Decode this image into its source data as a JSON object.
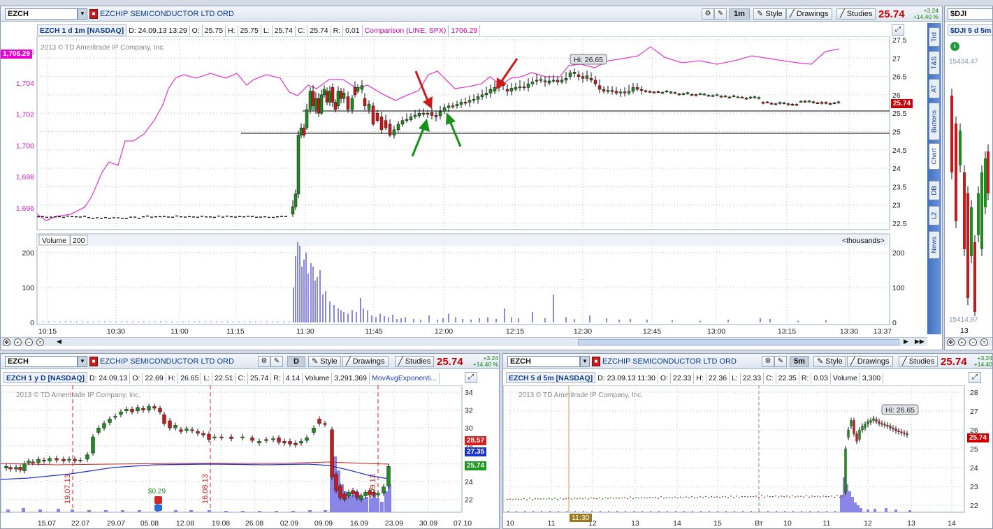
{
  "main": {
    "symbol": "EZCH",
    "company": "EZCHIP SEMICONDUCTOR LTD ORD",
    "timeframe": "1m",
    "style_label": "Style",
    "drawings_label": "Drawings",
    "studies_label": "Studies",
    "last_price": "25.74",
    "change": "+3.24",
    "change_pct": "+14.40 %",
    "info": {
      "title": "EZCH 1 d 1m [NASDAQ]",
      "date": "D: 24.09.13 13:29",
      "o_label": "O:",
      "o": "25.75",
      "h_label": "H:",
      "h": "25.75",
      "l_label": "L:",
      "l": "25.74",
      "c_label": "C:",
      "c": "25.74",
      "r_label": "R:",
      "r": "0.01",
      "comparison": "Comparison (LINE, SPX)",
      "comparison_value": "1706.29"
    },
    "copyright": "2013 © TD Ameritrade IP Company, Inc.",
    "comparison_tag": "1,706.29",
    "price_tag": "25.74",
    "hi_label": "Hi: 26.65",
    "left_axis": [
      "1,706",
      "1,704",
      "1,702",
      "1,700",
      "1,698",
      "1,696"
    ],
    "right_axis": [
      "27.5",
      "27",
      "26.5",
      "26",
      "25.5",
      "25",
      "24.5",
      "24",
      "23.5",
      "23",
      "22.5"
    ],
    "volume_label": "Volume",
    "volume_value": "200",
    "volume_units": "<thousands>",
    "volume_axis": [
      "200",
      "100",
      "0"
    ],
    "time_axis": [
      "10:15",
      "10:30",
      "11:00",
      "11:15",
      "11:30",
      "11:45",
      "12:00",
      "12:15",
      "12:30",
      "12:45",
      "13:00",
      "13:15",
      "13:30",
      "13:37"
    ],
    "side_tabs": [
      "Trd",
      "T&S",
      "AT",
      "Buttons",
      "Chart",
      "DB",
      "L2",
      "News"
    ]
  },
  "right_panel": {
    "symbol": "$DJI",
    "info_title": "$DJI 5 d 5m",
    "price_top": "15434.47",
    "price_bottom": "15414.87",
    "change": "+3.24",
    "change_pct": "+14.40",
    "date_label": "13"
  },
  "bottom_left": {
    "symbol": "EZCH",
    "company": "EZCHIP SEMICONDUCTOR LTD ORD",
    "timeframe": "D",
    "style_label": "Style",
    "drawings_label": "Drawings",
    "studies_label": "Studies",
    "last_price": "25.74",
    "change": "+3.24",
    "change_pct": "+14.40 %",
    "info": {
      "title": "EZCH 1 y D [NASDAQ]",
      "date": "D: 24.09.13",
      "o_label": "O:",
      "o": "22.69",
      "h_label": "H:",
      "h": "26.65",
      "l_label": "L:",
      "l": "22.51",
      "c_label": "C:",
      "c": "25.74",
      "r_label": "R:",
      "r": "4.14",
      "vol_label": "Volume",
      "vol": "3,291,369",
      "study": "MovAvgExponenti..."
    },
    "copyright": "2013 © TD Ameritrade IP Company, Inc.",
    "right_axis": [
      "34",
      "32",
      "30",
      "28",
      "26",
      "24",
      "22"
    ],
    "tags": {
      "red": "28.57",
      "blue": "27.35",
      "green": "25.74"
    },
    "dividend": "$0.29",
    "event_dates": [
      "19.07.13",
      "16.08.13",
      "20.09.13"
    ],
    "time_axis": [
      "15.07",
      "22.07",
      "29.07",
      "05.08",
      "12.08",
      "19.08",
      "26.08",
      "02.09",
      "09.09",
      "16.09",
      "23.09",
      "30.09",
      "07.10"
    ]
  },
  "bottom_right": {
    "symbol": "EZCH",
    "company": "EZCHIP SEMICONDUCTOR LTD ORD",
    "timeframe": "5m",
    "style_label": "Style",
    "drawings_label": "Drawings",
    "studies_label": "Studies",
    "last_price": "25.74",
    "change": "+3.24",
    "change_pct": "+14.40",
    "info": {
      "title": "EZCH 5 d 5m [NASDAQ]",
      "date": "D: 23.09.13 11:30",
      "o_label": "O:",
      "o": "22.33",
      "h_label": "H:",
      "h": "22.36",
      "l_label": "L:",
      "l": "22.33",
      "c_label": "C:",
      "c": "22.35",
      "r_label": "R:",
      "r": "0.03",
      "vol_label": "Volume",
      "vol": "3,300"
    },
    "copyright": "2013 © TD Ameritrade IP Company, Inc.",
    "hi_label": "Hi: 26.65",
    "price_tag": "25.74",
    "right_axis": [
      "28",
      "27",
      "26",
      "25",
      "24",
      "23",
      "22"
    ],
    "time_axis": [
      "10",
      "11",
      "12",
      "13",
      "14",
      "15",
      "Вт",
      "10",
      "11",
      "12",
      "13",
      "14"
    ],
    "cursor_time": "11:30"
  }
}
